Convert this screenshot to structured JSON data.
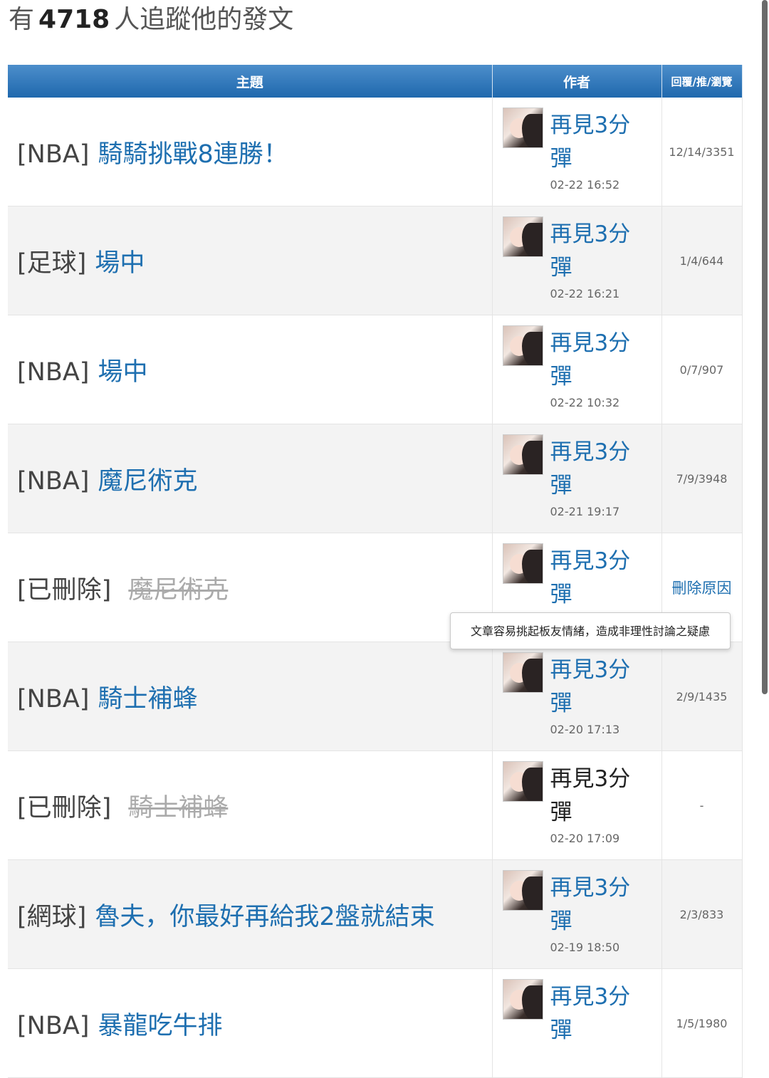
{
  "header": {
    "prefix": "有",
    "follower_count": "4718",
    "suffix": "人追蹤他的發文"
  },
  "table": {
    "columns": [
      "主題",
      "作者",
      "回覆/推/瀏覽"
    ],
    "rows": [
      {
        "category": "[NBA]",
        "title": "騎騎挑戰8連勝！",
        "deleted": false,
        "author": "再見3分彈",
        "time": "02-22 16:52",
        "stats": "12/14/3351"
      },
      {
        "category": "[足球]",
        "title": "場中",
        "deleted": false,
        "author": "再見3分彈",
        "time": "02-22 16:21",
        "stats": "1/4/644"
      },
      {
        "category": "[NBA]",
        "title": "場中",
        "deleted": false,
        "author": "再見3分彈",
        "time": "02-22 10:32",
        "stats": "0/7/907"
      },
      {
        "category": "[NBA]",
        "title": "魔尼術克",
        "deleted": false,
        "author": "再見3分彈",
        "time": "02-21 19:17",
        "stats": "7/9/3948"
      },
      {
        "category": "[已刪除]",
        "title": "魔尼術克",
        "deleted": true,
        "author": "再見3分彈",
        "time": "",
        "stats": "刪除原因"
      },
      {
        "category": "[NBA]",
        "title": "騎士補蜂",
        "deleted": false,
        "author": "再見3分彈",
        "time": "02-20 17:13",
        "stats": "2/9/1435"
      },
      {
        "category": "[已刪除]",
        "title": "騎士補蜂",
        "deleted": true,
        "author": "再見3分彈",
        "time": "02-20 17:09",
        "stats": "-"
      },
      {
        "category": "[網球]",
        "title": "魯夫，你最好再給我2盤就結束",
        "deleted": false,
        "author": "再見3分彈",
        "time": "02-19 18:50",
        "stats": "2/3/833"
      },
      {
        "category": "[NBA]",
        "title": "暴龍吃牛排",
        "deleted": false,
        "author": "再見3分彈",
        "time": "",
        "stats": "1/5/1980"
      }
    ]
  },
  "tooltip": {
    "text": "文章容易挑起板友情緒，造成非理性討論之疑慮"
  }
}
